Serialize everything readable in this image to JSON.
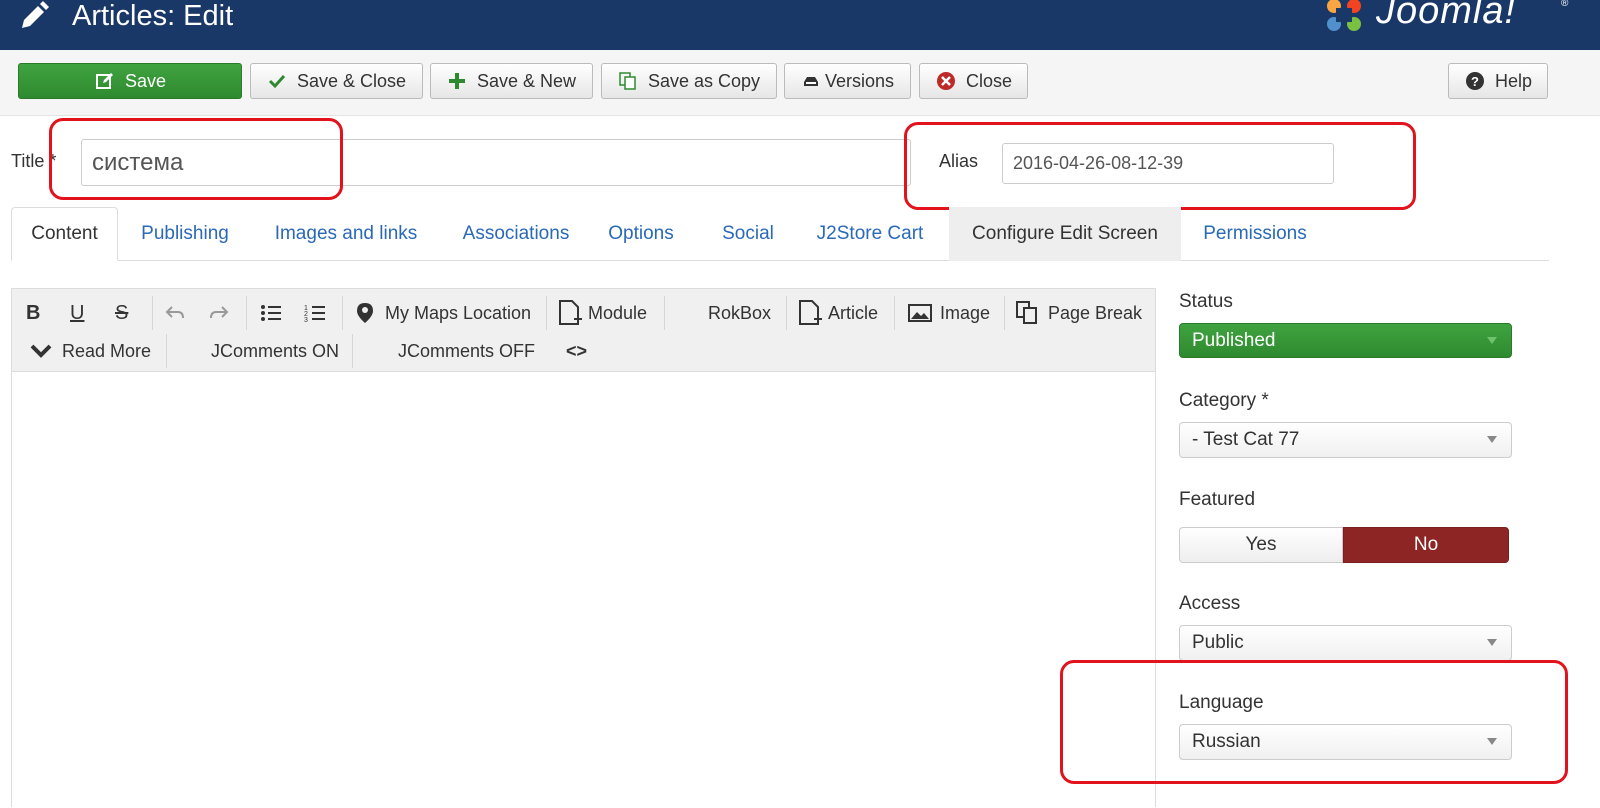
{
  "header": {
    "title": "Articles: Edit",
    "logo_text": "Joomla!",
    "logo_reg": "®"
  },
  "toolbar": {
    "save": "Save",
    "save_close": "Save & Close",
    "save_new": "Save & New",
    "save_copy": "Save as Copy",
    "versions": "Versions",
    "close": "Close",
    "help": "Help"
  },
  "form": {
    "title_label": "Title",
    "title_required": " *",
    "title_value": "система",
    "alias_label": "Alias",
    "alias_value": "2016-04-26-08-12-39"
  },
  "tabs": [
    "Content",
    "Publishing",
    "Images and links",
    "Associations",
    "Options",
    "Social",
    "J2Store Cart",
    "Configure Edit Screen",
    "Permissions"
  ],
  "editor": {
    "bold": "B",
    "underline": "U",
    "strike": "S",
    "my_maps": "My Maps Location",
    "module": "Module",
    "rokbox": "RokBox",
    "article": "Article",
    "image": "Image",
    "page_break": "Page Break",
    "read_more": "Read More",
    "jcomments_on": "JComments ON",
    "jcomments_off": "JComments OFF",
    "code": "<>"
  },
  "sidebar": {
    "status_label": "Status",
    "status_value": "Published",
    "category_label": "Category *",
    "category_value": "- Test Cat 77",
    "featured_label": "Featured",
    "featured_yes": "Yes",
    "featured_no": "No",
    "access_label": "Access",
    "access_value": "Public",
    "language_label": "Language",
    "language_value": "Russian"
  },
  "colors": {
    "header_bg": "#1a3867",
    "save_green": "#2f8a2f",
    "featured_no_red": "#8e2525",
    "highlight_red": "#e2131d",
    "link_blue": "#2a69b8"
  }
}
